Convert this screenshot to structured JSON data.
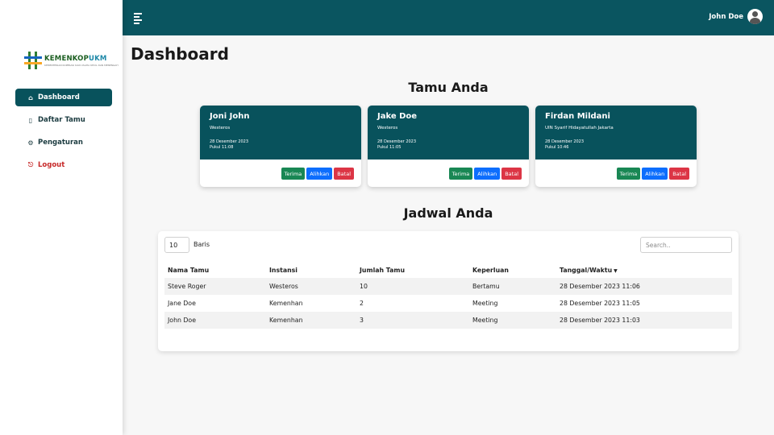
{
  "sidebar": {
    "logo": {
      "title_a": "KEMENKOP",
      "title_b": "UKM",
      "subtitle": "KEMENTERIAN KOPERASI DAN USAHA KECIL DAN MENENGAH"
    },
    "items": [
      {
        "label": "Dashboard",
        "icon": "home-icon",
        "glyph": "⌂",
        "active": true
      },
      {
        "label": "Daftar Tamu",
        "icon": "clipboard-icon",
        "glyph": "▯"
      },
      {
        "label": "Pengaturan",
        "icon": "gear-icon",
        "glyph": "⚙"
      },
      {
        "label": "Logout",
        "icon": "logout-icon",
        "glyph": "⎋"
      }
    ]
  },
  "header": {
    "user_name": "John Doe"
  },
  "page_title": "Dashboard",
  "guests_section": {
    "title": "Tamu Anda",
    "cards": [
      {
        "name": "Joni John",
        "institution": "Westeros",
        "date": "28 Desember 2023",
        "time": "Pukul 11:08"
      },
      {
        "name": "Jake Doe",
        "institution": "Westeros",
        "date": "28 Desember 2023",
        "time": "Pukul 11:05"
      },
      {
        "name": "Firdan Mildani",
        "institution": "UIN Syarif Hidayatullah Jakarta",
        "date": "28 Desember 2023",
        "time": "Pukul 10:46"
      }
    ],
    "buttons": {
      "accept": "Terima",
      "redirect": "Alihkan",
      "cancel": "Batal"
    }
  },
  "schedule_section": {
    "title": "Jadwal Anda",
    "length_value": "10",
    "length_label": "Baris",
    "search_placeholder": "Search..",
    "columns": [
      "Nama Tamu",
      "Instansi",
      "Jumlah Tamu",
      "Keperluan",
      "Tanggal/Waktu"
    ],
    "rows": [
      [
        "Steve Roger",
        "Westeros",
        "10",
        "Bertamu",
        "28 Desember 2023 11:06"
      ],
      [
        "Jane Doe",
        "Kemenhan",
        "2",
        "Meeting",
        "28 Desember 2023 11:05"
      ],
      [
        "John Doe",
        "Kemenhan",
        "3",
        "Meeting",
        "28 Desember 2023 11:03"
      ]
    ]
  },
  "colors": {
    "primary": "#0a5560",
    "accept": "#198754",
    "redirect": "#0d6efd",
    "cancel": "#dc3545"
  }
}
